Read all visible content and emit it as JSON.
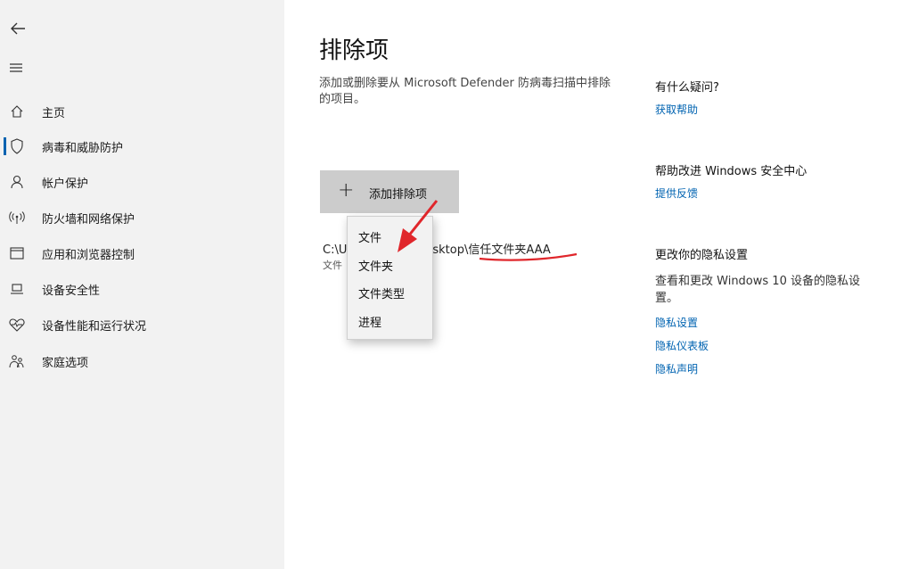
{
  "sidebar": {
    "items": [
      {
        "label": "主页",
        "icon": "home-icon"
      },
      {
        "label": "病毒和威胁防护",
        "icon": "shield-icon",
        "selected": true
      },
      {
        "label": "帐户保护",
        "icon": "person-icon"
      },
      {
        "label": "防火墙和网络保护",
        "icon": "antenna-icon"
      },
      {
        "label": "应用和浏览器控制",
        "icon": "browser-window-icon"
      },
      {
        "label": "设备安全性",
        "icon": "laptop-icon"
      },
      {
        "label": "设备性能和运行状况",
        "icon": "heart-pulse-icon"
      },
      {
        "label": "家庭选项",
        "icon": "family-icon"
      }
    ]
  },
  "main": {
    "title": "排除项",
    "description": "添加或删除要从 Microsoft Defender 防病毒扫描中排除的项目。",
    "add_button_label": "添加排除项",
    "exclusion": {
      "path": "C:\\U",
      "path_tail": "sktop\\信任文件夹AAA",
      "type": "文件"
    }
  },
  "dropdown": {
    "items": [
      "文件",
      "文件夹",
      "文件类型",
      "进程"
    ]
  },
  "right": {
    "help_heading": "有什么疑问?",
    "help_link": "获取帮助",
    "improve_heading": "帮助改进 Windows 安全中心",
    "feedback_link": "提供反馈",
    "privacy_heading": "更改你的隐私设置",
    "privacy_text": "查看和更改 Windows 10 设备的隐私设置。",
    "privacy_links": [
      "隐私设置",
      "隐私仪表板",
      "隐私声明"
    ]
  },
  "colors": {
    "accent": "#0063b1",
    "annotation": "#e0262b",
    "sidebar_bg": "#f2f2f2",
    "button_bg": "#cccccc"
  }
}
